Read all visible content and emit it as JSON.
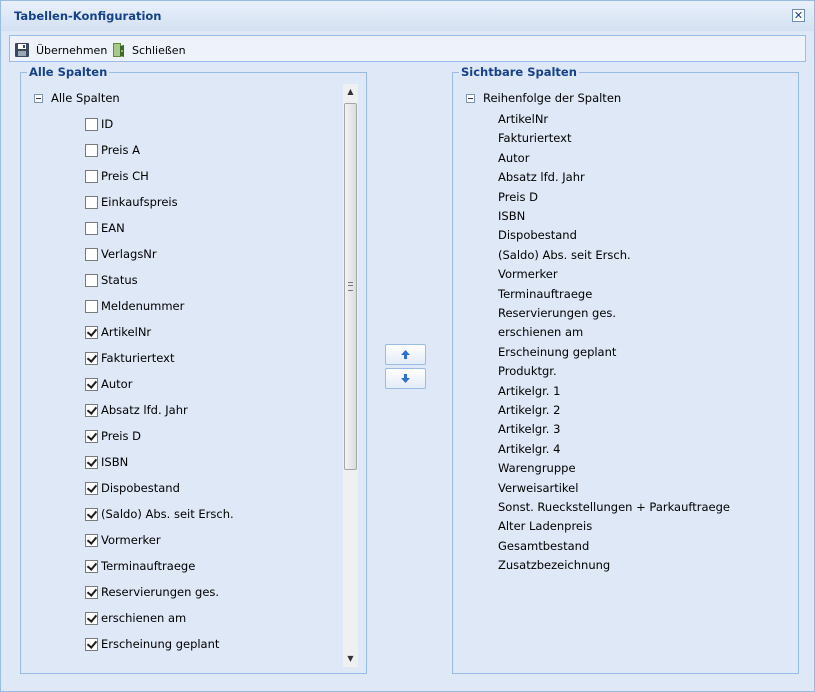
{
  "window": {
    "title": "Tabellen-Konfiguration",
    "close_glyph": "✕"
  },
  "toolbar": {
    "apply_label": "Übernehmen",
    "close_label": "Schließen",
    "apply_icon": "save-icon",
    "close_icon": "exit-door-icon"
  },
  "left_panel": {
    "legend": "Alle Spalten",
    "root_label": "Alle Spalten",
    "items": [
      {
        "label": "ID",
        "checked": false
      },
      {
        "label": "Preis A",
        "checked": false
      },
      {
        "label": "Preis CH",
        "checked": false
      },
      {
        "label": "Einkaufspreis",
        "checked": false
      },
      {
        "label": "EAN",
        "checked": false
      },
      {
        "label": "VerlagsNr",
        "checked": false
      },
      {
        "label": "Status",
        "checked": false
      },
      {
        "label": "Meldenummer",
        "checked": false
      },
      {
        "label": "ArtikelNr",
        "checked": true
      },
      {
        "label": "Fakturiertext",
        "checked": true
      },
      {
        "label": "Autor",
        "checked": true
      },
      {
        "label": "Absatz lfd. Jahr",
        "checked": true
      },
      {
        "label": "Preis D",
        "checked": true
      },
      {
        "label": "ISBN",
        "checked": true
      },
      {
        "label": "Dispobestand",
        "checked": true
      },
      {
        "label": "(Saldo) Abs. seit Ersch.",
        "checked": true
      },
      {
        "label": "Vormerker",
        "checked": true
      },
      {
        "label": "Terminauftraege",
        "checked": true
      },
      {
        "label": "Reservierungen ges.",
        "checked": true
      },
      {
        "label": "erschienen am",
        "checked": true
      },
      {
        "label": "Erscheinung geplant",
        "checked": true
      }
    ]
  },
  "move_buttons": {
    "up_icon": "arrow-up-icon",
    "down_icon": "arrow-down-icon"
  },
  "right_panel": {
    "legend": "Sichtbare Spalten",
    "root_label": "Reihenfolge der Spalten",
    "items": [
      "ArtikelNr",
      "Fakturiertext",
      "Autor",
      "Absatz lfd. Jahr",
      "Preis D",
      "ISBN",
      "Dispobestand",
      "(Saldo) Abs. seit Ersch.",
      "Vormerker",
      "Terminauftraege",
      "Reservierungen ges.",
      "erschienen am",
      "Erscheinung geplant",
      "Produktgr.",
      "Artikelgr. 1",
      "Artikelgr. 2",
      "Artikelgr. 3",
      "Artikelgr. 4",
      "Warengruppe",
      "Verweisartikel",
      "Sonst. Rueckstellungen + Parkauftraege",
      "Alter Ladenpreis",
      "Gesamtbestand",
      "Zusatzbezeichnung"
    ]
  }
}
